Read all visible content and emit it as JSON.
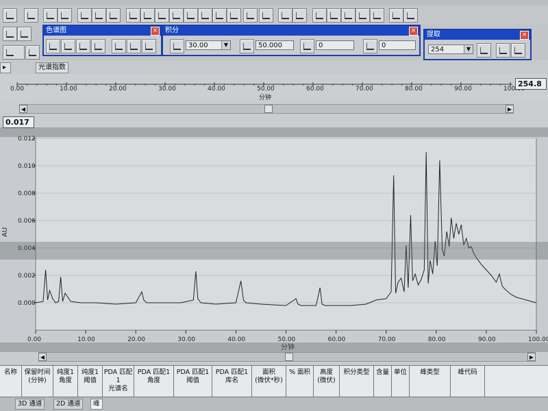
{
  "panels": {
    "chromatogram": {
      "title": "色谱图"
    },
    "integration": {
      "title": "积分",
      "width_value": "30.00",
      "threshold_value": "50.000",
      "min_area_value": "0",
      "min_height_value": "0"
    },
    "extract": {
      "title": "提取",
      "wavelength_value": "254"
    }
  },
  "tabs": {
    "spectrum_index": "光谱指数"
  },
  "top_axis": {
    "label": "分钟",
    "ticks": [
      "0.00",
      "10.00",
      "20.00",
      "30.00",
      "40.00",
      "50.00",
      "60.00",
      "70.00",
      "80.00",
      "90.00",
      "100.00"
    ],
    "end_readout": "254.8",
    "value_readout": "0.017"
  },
  "chart_data": {
    "type": "line",
    "xlabel": "分钟",
    "ylabel": "AU",
    "xlim": [
      0,
      100
    ],
    "ylim": [
      -0.002,
      0.012
    ],
    "x_ticks": [
      "0.00",
      "10.00",
      "20.00",
      "30.00",
      "40.00",
      "50.00",
      "60.00",
      "70.00",
      "80.00",
      "90.00",
      "100.00"
    ],
    "y_ticks": [
      "0.000",
      "0.002",
      "0.004",
      "0.006",
      "0.008",
      "0.010",
      "0.012"
    ],
    "series": [
      {
        "x": [
          0,
          1.5,
          2.0,
          2.4,
          2.8,
          3.4,
          4.0,
          4.6,
          5.0,
          5.4,
          5.9,
          7,
          9,
          12,
          16,
          20,
          21.2,
          21.6,
          22.2,
          25,
          29,
          31.5,
          32.0,
          32.4,
          33.0,
          36,
          40,
          41.0,
          41.5,
          42.0,
          45,
          50,
          52.0,
          52.4,
          53,
          56,
          56.8,
          57.2,
          57.8,
          60,
          63,
          66,
          68,
          70,
          71.0,
          71.5,
          71.9,
          72.4,
          73,
          73.6,
          74.0,
          74.4,
          74.9,
          75.3,
          75.8,
          76.4,
          77,
          77.6,
          78.0,
          78.4,
          78.8,
          79.3,
          79.8,
          80.2,
          80.7,
          81.2,
          81.6,
          82.1,
          82.6,
          83.0,
          83.5,
          84.0,
          84.5,
          85.0,
          85.5,
          86.0,
          86.5,
          87.0,
          87.5,
          88.0,
          89.0,
          90.0,
          91.0,
          92.0,
          92.6,
          93.2,
          94.0,
          95.0,
          96.0,
          97.0,
          98.0,
          99.0,
          100.0
        ],
        "y": [
          0.0,
          0.0001,
          0.0024,
          0.0002,
          0.0009,
          0.0003,
          0.0,
          0.0001,
          0.0019,
          0.0001,
          0.0007,
          0.0001,
          0.0,
          0.0,
          -0.0001,
          0.0,
          0.0008,
          0.0002,
          0.0,
          0.0,
          0.0,
          0.0002,
          0.0023,
          0.0003,
          0.0,
          -0.0001,
          0.0,
          0.0016,
          0.0002,
          0.0,
          -0.0001,
          -0.0002,
          0.0003,
          -0.0001,
          -0.0002,
          -0.0002,
          0.0011,
          -0.0001,
          -0.0002,
          -0.0002,
          -0.0002,
          -0.0001,
          0.0002,
          0.0003,
          0.0008,
          0.0093,
          0.0007,
          0.0015,
          0.0018,
          0.0008,
          0.0042,
          0.0011,
          0.0064,
          0.0016,
          0.0021,
          0.0013,
          0.0017,
          0.0024,
          0.011,
          0.0014,
          0.0031,
          0.0021,
          0.0045,
          0.0027,
          0.0104,
          0.0039,
          0.0034,
          0.0052,
          0.0041,
          0.0062,
          0.0047,
          0.0058,
          0.005,
          0.0057,
          0.0042,
          0.0047,
          0.004,
          0.0041,
          0.0036,
          0.0033,
          0.0028,
          0.0024,
          0.002,
          0.0015,
          0.0021,
          0.0012,
          0.0009,
          0.0006,
          0.0004,
          0.0003,
          0.0002,
          0.0001,
          0.0
        ]
      }
    ]
  },
  "table": {
    "headers": [
      "名称",
      "保留时间\n(分钟)",
      "纯度1\n角度",
      "纯度1\n阈值",
      "PDA 匹配1\n光谱名",
      "PDA 匹配1\n角度",
      "PDA 匹配1\n阈值",
      "PDA 匹配1\n库名",
      "面积\n(微伏*秒)",
      "% 面积",
      "高度\n(微伏)",
      "积分类型",
      "含量",
      "单位",
      "峰类型",
      "峰代码"
    ]
  },
  "bottom_tabs": [
    "3D 通道",
    "2D 通道",
    "峰"
  ]
}
